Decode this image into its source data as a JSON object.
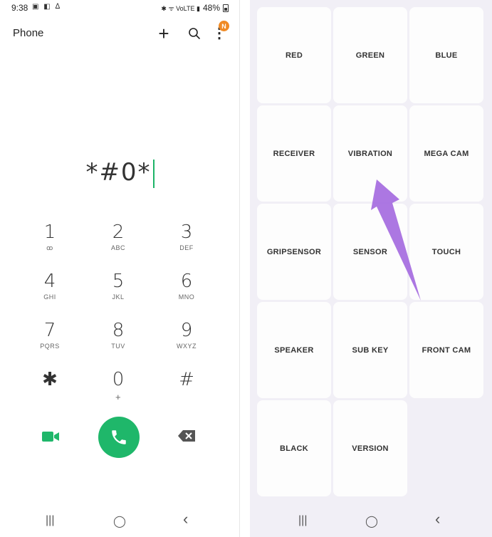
{
  "status_bar": {
    "time": "9:38",
    "notifications": "▣ ◧ ᐃ",
    "signal": "✱ ᯤ VoLTE ▮",
    "battery": "48%"
  },
  "app_bar": {
    "title": "Phone",
    "add_icon": "+",
    "more_icon": "⋮",
    "badge": "N"
  },
  "dialer": {
    "entered": "*#0*",
    "keys": [
      {
        "digit": "1",
        "letters": "ꝏ"
      },
      {
        "digit": "2",
        "letters": "ABC"
      },
      {
        "digit": "3",
        "letters": "DEF"
      },
      {
        "digit": "4",
        "letters": "GHI"
      },
      {
        "digit": "5",
        "letters": "JKL"
      },
      {
        "digit": "6",
        "letters": "MNO"
      },
      {
        "digit": "7",
        "letters": "PQRS"
      },
      {
        "digit": "8",
        "letters": "TUV"
      },
      {
        "digit": "9",
        "letters": "WXYZ"
      },
      {
        "digit": "✱",
        "letters": ""
      },
      {
        "digit": "0",
        "letters": "+"
      },
      {
        "digit": "#",
        "letters": ""
      }
    ]
  },
  "nav": {
    "recents": "|||",
    "home": "◯",
    "back": "‹"
  },
  "test_menu": {
    "tiles": [
      "RED",
      "GREEN",
      "BLUE",
      "RECEIVER",
      "VIBRATION",
      "MEGA CAM",
      "GRIPSENSOR",
      "SENSOR",
      "TOUCH",
      "SPEAKER",
      "SUB KEY",
      "FRONT CAM",
      "BLACK",
      "VERSION",
      ""
    ]
  },
  "colors": {
    "call_green": "#1fb76a",
    "badge_orange": "#f08a24",
    "arrow_purple": "#a56be0",
    "menu_bg": "#f1eff6"
  }
}
